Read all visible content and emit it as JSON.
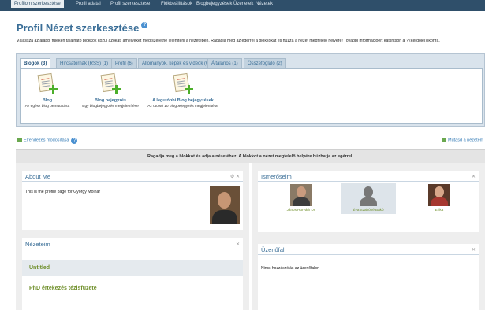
{
  "topnav": {
    "tabs": [
      "Profilom szerkesztése",
      "Profil adatai",
      "Profil szerkesztése",
      "Fiókbeállítások",
      "Blogbejegyzések",
      "Üzenetek",
      "Nézetek"
    ]
  },
  "header": {
    "title": "Profil Nézet szerkesztése",
    "help": "?",
    "intro": "Válassza az alábbi füleken található blokkok közül azokat, amelyeket meg szeretne jeleníteni a nézetében. Ragadja meg az egérrel a blokkokat és húzza a nézet megfelelő helyére! További információért kattintson a ? (kérdőjel) ikonra."
  },
  "block_tabs": [
    {
      "label": "Blogok (3)"
    },
    {
      "label": "Hírcsatornák (RSS) (1)"
    },
    {
      "label": "Profil (6)"
    },
    {
      "label": "Állományok, képek és videók (6)"
    },
    {
      "label": "Általános (1)"
    },
    {
      "label": "Összefoglaló (2)"
    }
  ],
  "blocks": [
    {
      "name": "Blog",
      "desc": "Az egész blog bemutatása"
    },
    {
      "name": "Blog bejegyzés",
      "desc": "Egy blogbejegyzés megjelenítése"
    },
    {
      "name": "A legutóbbi Blog bejegyzések",
      "desc": "Az utolsó 10 blogbejegyzés megjelenítése"
    }
  ],
  "links": {
    "layout": "Elrendezés módosítása",
    "show_view": "Mutasd a nézetem"
  },
  "hint": "Ragadja meg a blokkot és adja a nézetéhez. A blokkot a nézet megfelelő helyére húzhatja az egérrel.",
  "left_column": {
    "about": {
      "title": "About Me",
      "controls": "⚙ ✕",
      "text": "This is the profile page for György Molnár"
    },
    "views": {
      "title": "Nézeteim",
      "controls": "✕",
      "items": [
        "Untitled",
        "PhD értekezés tézisfüzete"
      ]
    }
  },
  "right_column": {
    "friends": {
      "title": "Ismerőseim",
      "controls": "✕",
      "people": [
        "János Horváth Dr.",
        "Éva Szabóné Bakó",
        "Erika"
      ]
    },
    "wall": {
      "title": "Üzenőfal",
      "controls": "✕",
      "text": "Nincs hozzászólás az üzenőfalon"
    }
  },
  "colors": {
    "accent": "#3a6e97",
    "link_green": "#6f8f2a",
    "panel_bg": "#d9e3ec"
  }
}
